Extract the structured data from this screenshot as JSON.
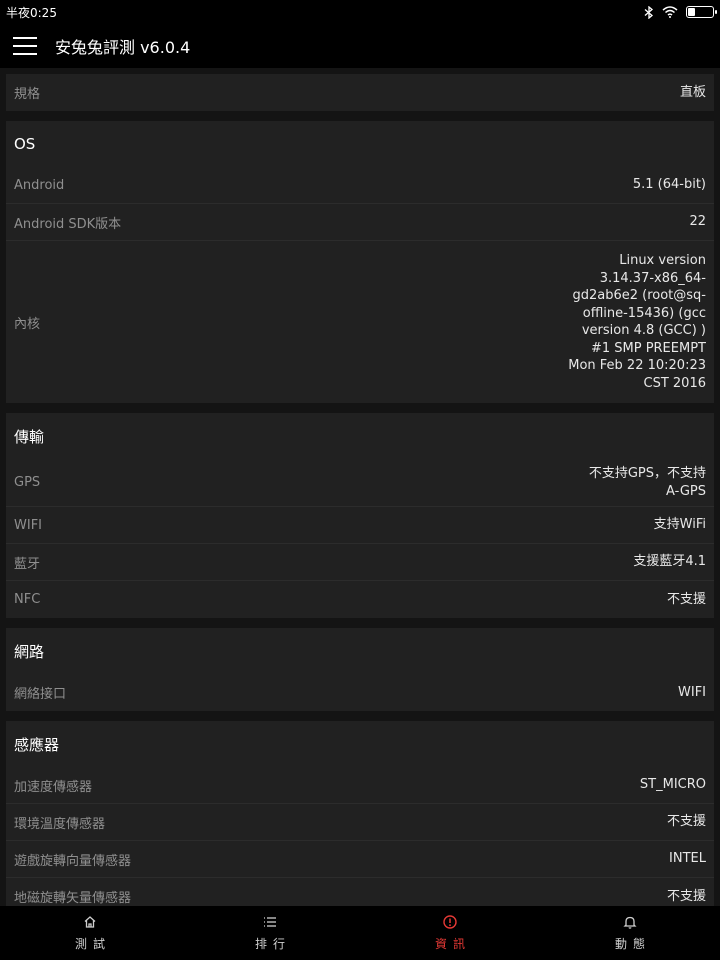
{
  "status": {
    "time": "半夜0:25",
    "battery_level": 0.3
  },
  "toolbar": {
    "title": "安兔兔評測 v6.0.4"
  },
  "sections": {
    "top": {
      "label": "規格",
      "value": "直板"
    },
    "os": {
      "title": "OS",
      "android": {
        "label": "Android",
        "value": "5.1 (64-bit)"
      },
      "sdk": {
        "label": "Android SDK版本",
        "value": "22"
      },
      "kernel": {
        "label": "內核",
        "value": "Linux version\n3.14.37-x86_64-\ngd2ab6e2 (root@sq-\noffline-15436) (gcc\nversion 4.8 (GCC) )\n#1 SMP PREEMPT\nMon Feb 22 10:20:23\nCST 2016"
      }
    },
    "transfer": {
      "title": "傳輸",
      "gps": {
        "label": "GPS",
        "value": "不支持GPS，不支持\nA-GPS"
      },
      "wifi": {
        "label": "WIFI",
        "value": "支持WiFi"
      },
      "bluetooth": {
        "label": "藍牙",
        "value": "支援藍牙4.1"
      },
      "nfc": {
        "label": "NFC",
        "value": "不支援"
      }
    },
    "network": {
      "title": "網路",
      "interface": {
        "label": "網絡接口",
        "value": "WIFI"
      }
    },
    "sensors": {
      "title": "感應器",
      "accel": {
        "label": "加速度傳感器",
        "value": "ST_MICRO"
      },
      "temp": {
        "label": "環境溫度傳感器",
        "value": "不支援"
      },
      "game_rot": {
        "label": "遊戲旋轉向量傳感器",
        "value": "INTEL"
      },
      "geo_rot": {
        "label": "地磁旋轉矢量傳感器",
        "value": "不支援"
      }
    }
  },
  "nav": {
    "test": "測試",
    "rank": "排行",
    "info": "資訊",
    "news": "動態",
    "active_color": "#e53935"
  }
}
